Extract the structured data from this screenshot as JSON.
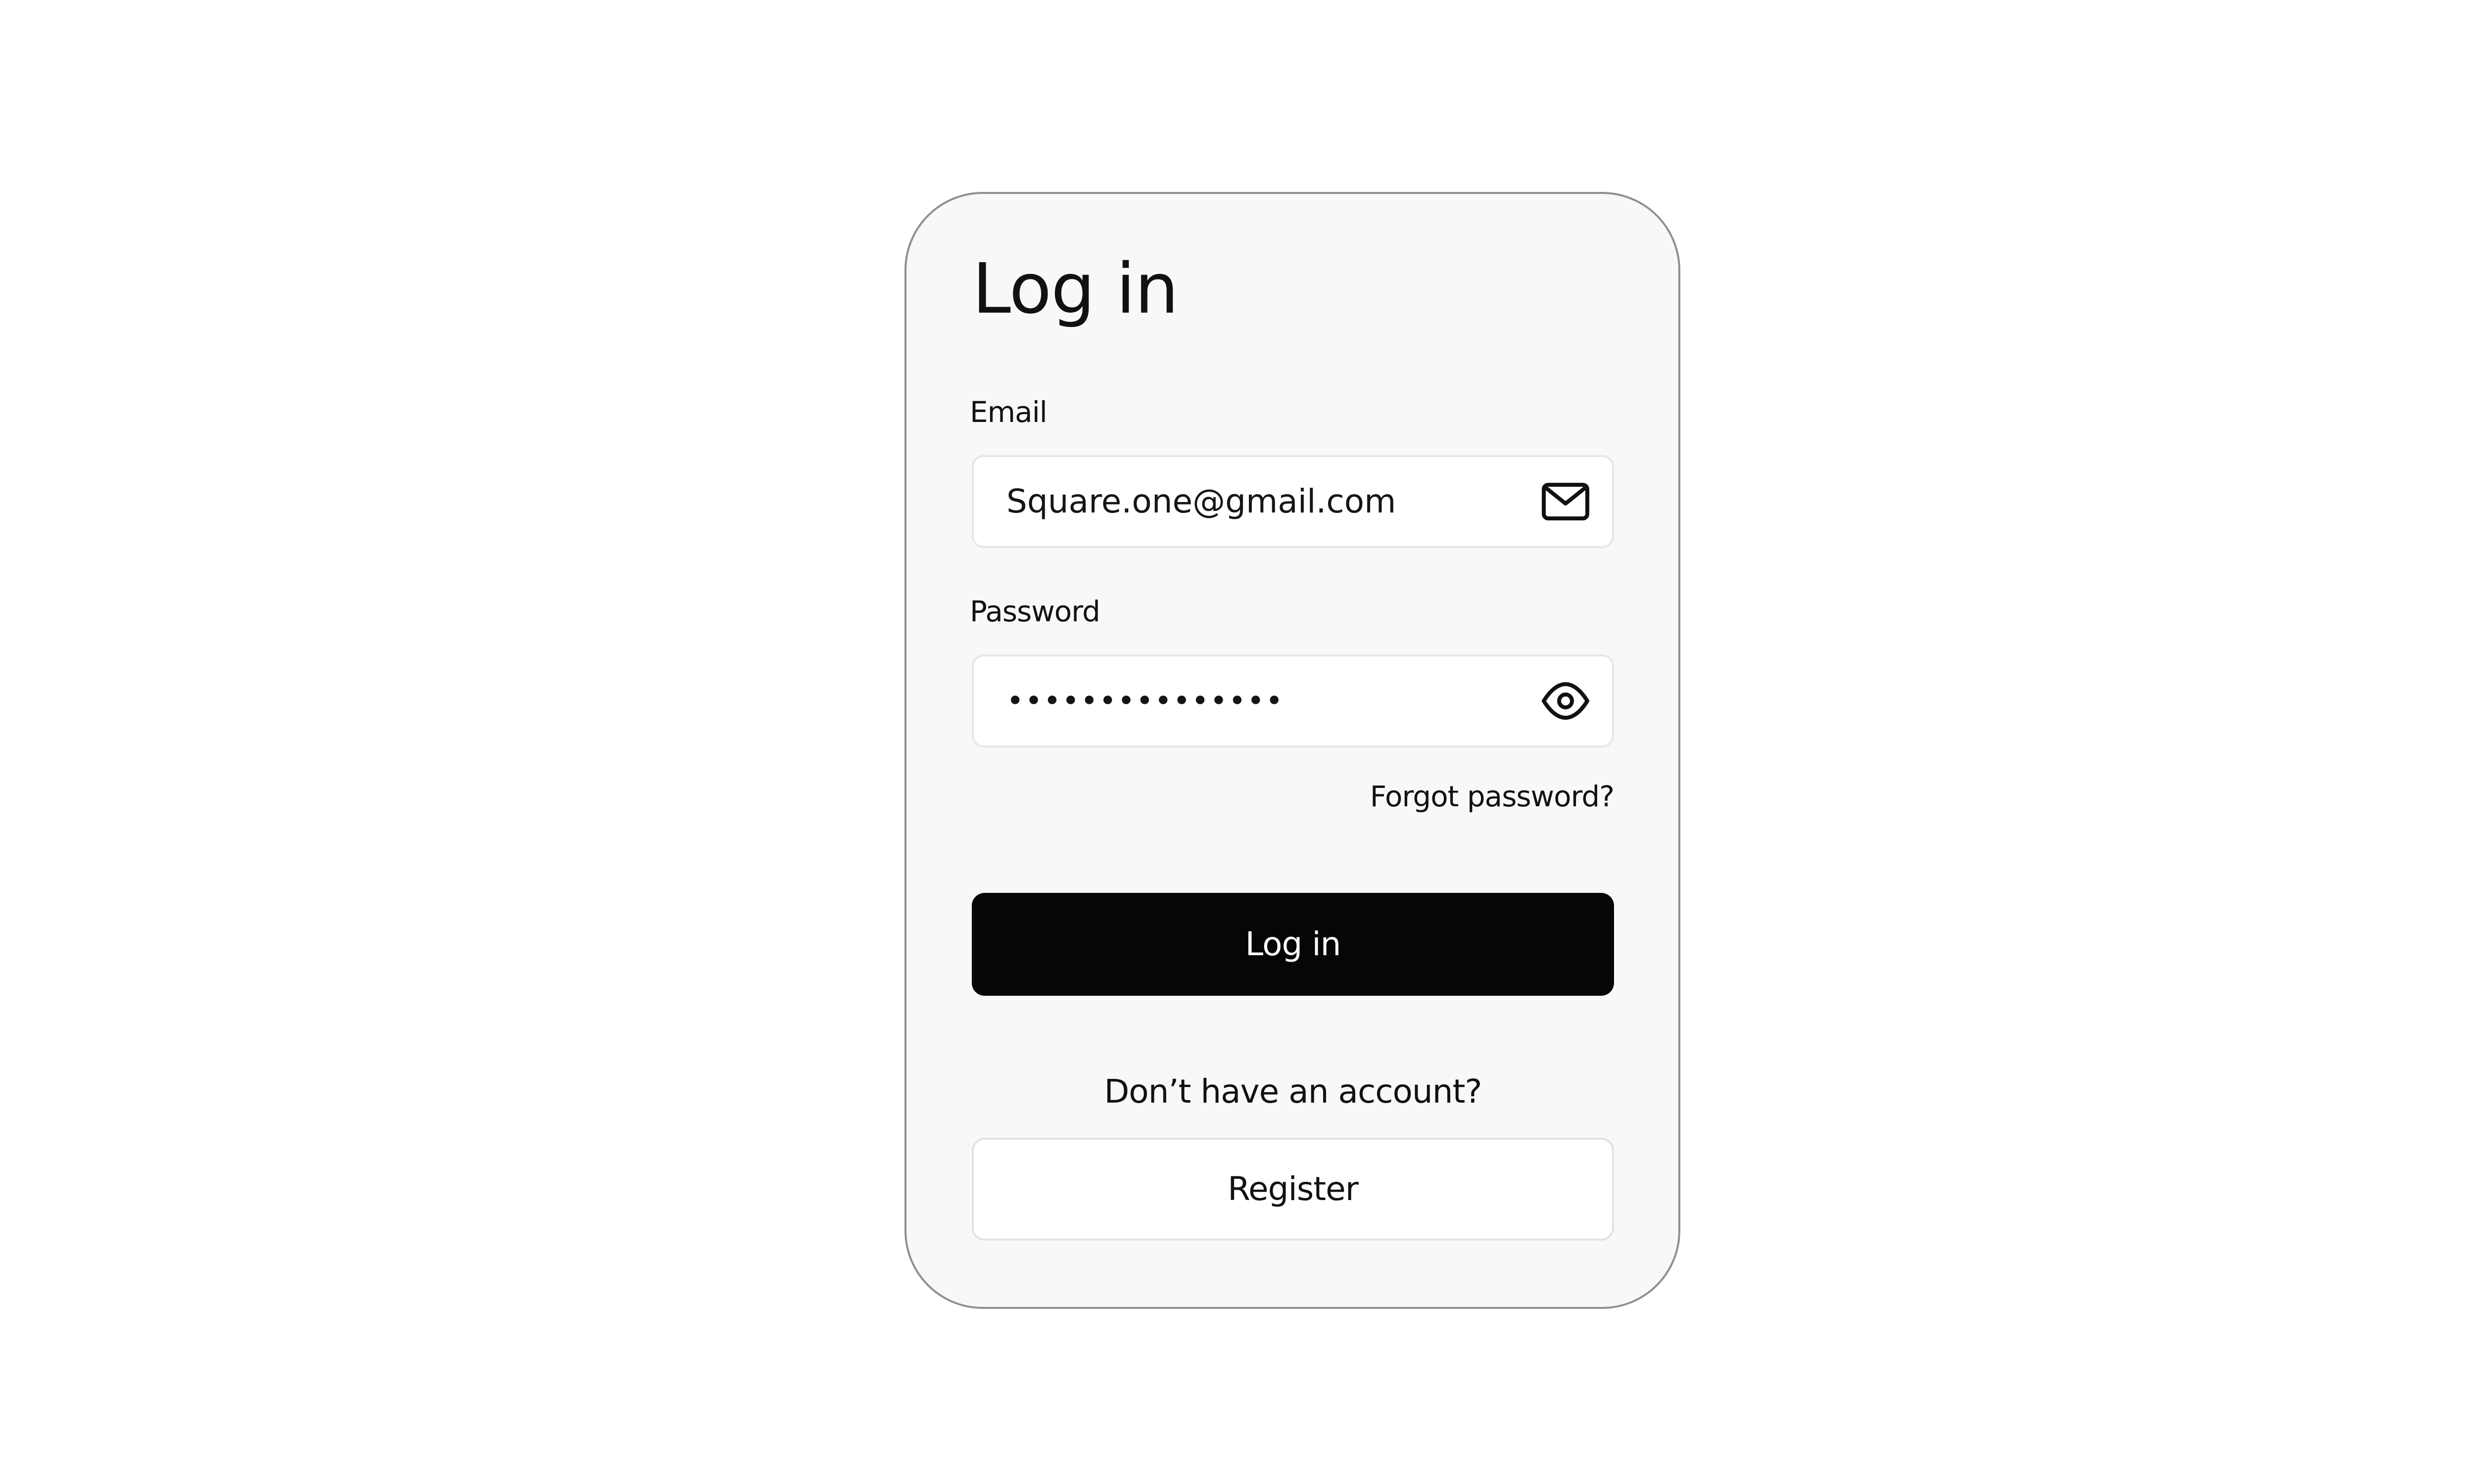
{
  "login_form": {
    "title": "Log in",
    "email": {
      "label": "Email",
      "value": "Square.one@gmail.com",
      "icon": "mail-icon"
    },
    "password": {
      "label": "Password",
      "value": "•••••••••••••••",
      "icon": "eye-icon"
    },
    "forgot_password": "Forgot password?",
    "login_button": "Log in",
    "no_account_text": "Don’t have an account?",
    "register_button": "Register"
  },
  "colors": {
    "primary_button": "#060606",
    "card_background": "#f8f8f8",
    "card_border": "#8f8f8f"
  }
}
